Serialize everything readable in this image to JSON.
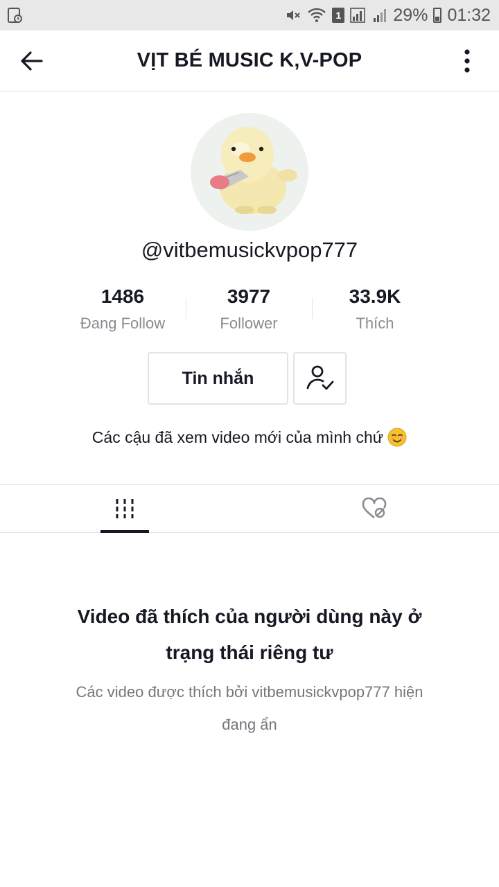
{
  "status_bar": {
    "battery": "29%",
    "time": "01:32",
    "sim": "1"
  },
  "header": {
    "title": "VỊT BÉ MUSIC K,V-POP"
  },
  "profile": {
    "username": "@vitbemusickvpop777",
    "stats": [
      {
        "value": "1486",
        "label": "Đang Follow"
      },
      {
        "value": "3977",
        "label": "Follower"
      },
      {
        "value": "33.9K",
        "label": "Thích"
      }
    ],
    "message_button": "Tin nhắn",
    "bio": "Các cậu đã xem video mới của mình chứ"
  },
  "tabs": [
    {
      "icon": "grid-icon",
      "active": true
    },
    {
      "icon": "liked-private-icon",
      "active": false
    }
  ],
  "empty_state": {
    "title": "Video đã thích của người dùng này ở trạng thái riêng tư",
    "description": "Các video được thích bởi vitbemusickvpop777 hiện đang ẩn"
  },
  "colors": {
    "text": "#161823",
    "secondary": "#8a8b91",
    "border": "#e3e3e4"
  }
}
